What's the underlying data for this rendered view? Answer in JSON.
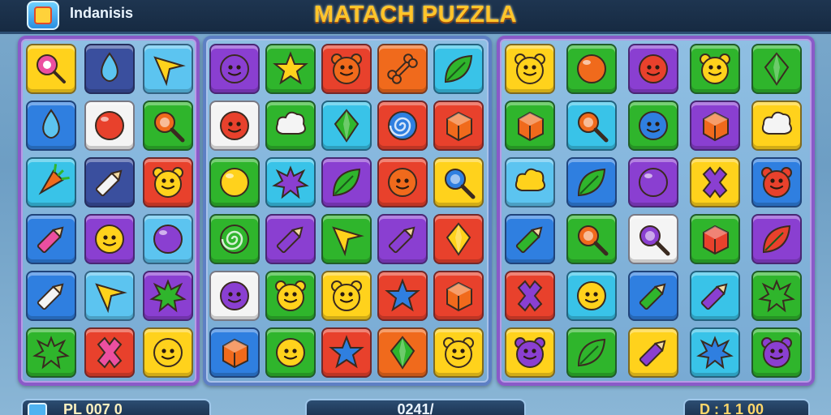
{
  "header": {
    "app_name": "Indanisis",
    "game_title": "MATACH PUZZLA"
  },
  "footer": {
    "left_text": "PL 007 0",
    "center_text": "0241/",
    "right_text": "D : 1 1 00"
  },
  "colors": {
    "red": "#e8412c",
    "orange": "#f06a1c",
    "yellow": "#ffd21c",
    "green": "#2fb52c",
    "lime": "#6ad12a",
    "blue": "#2f7fe0",
    "lightblue": "#5cc4f0",
    "purple": "#8a3fd1",
    "navy": "#3a4f9e",
    "white": "#f4f4f4",
    "pink": "#ec4fa0",
    "cyan": "#39c3e8"
  },
  "boards": [
    {
      "name": "board-left",
      "tiles": [
        {
          "bg": "yellow",
          "icon": "lollipop",
          "fg": "pink"
        },
        {
          "bg": "navy",
          "icon": "drop",
          "fg": "lightblue"
        },
        {
          "bg": "lightblue",
          "icon": "arrow",
          "fg": "yellow"
        },
        {
          "bg": "blue",
          "icon": "drop",
          "fg": "lightblue"
        },
        {
          "bg": "white",
          "icon": "ball",
          "fg": "red"
        },
        {
          "bg": "green",
          "icon": "magnifier",
          "fg": "orange"
        },
        {
          "bg": "cyan",
          "icon": "carrot",
          "fg": "orange"
        },
        {
          "bg": "navy",
          "icon": "pencil",
          "fg": "white"
        },
        {
          "bg": "red",
          "icon": "bear",
          "fg": "yellow"
        },
        {
          "bg": "blue",
          "icon": "pencil",
          "fg": "pink"
        },
        {
          "bg": "purple",
          "icon": "smiley",
          "fg": "yellow"
        },
        {
          "bg": "lightblue",
          "icon": "ball",
          "fg": "purple"
        },
        {
          "bg": "blue",
          "icon": "pencil",
          "fg": "white"
        },
        {
          "bg": "lightblue",
          "icon": "arrow",
          "fg": "yellow"
        },
        {
          "bg": "purple",
          "icon": "splat",
          "fg": "green"
        },
        {
          "bg": "green",
          "icon": "splat",
          "fg": "green"
        },
        {
          "bg": "red",
          "icon": "cross",
          "fg": "pink"
        },
        {
          "bg": "yellow",
          "icon": "smiley",
          "fg": "yellow"
        }
      ]
    },
    {
      "name": "board-middle",
      "tiles": [
        {
          "bg": "purple",
          "icon": "smiley",
          "fg": "purple"
        },
        {
          "bg": "green",
          "icon": "star",
          "fg": "yellow"
        },
        {
          "bg": "red",
          "icon": "bear",
          "fg": "orange"
        },
        {
          "bg": "orange",
          "icon": "bone",
          "fg": "orange"
        },
        {
          "bg": "cyan",
          "icon": "leaf",
          "fg": "green"
        },
        {
          "bg": "white",
          "icon": "smiley",
          "fg": "red"
        },
        {
          "bg": "green",
          "icon": "cloud",
          "fg": "white"
        },
        {
          "bg": "cyan",
          "icon": "gem",
          "fg": "green"
        },
        {
          "bg": "red",
          "icon": "swirl",
          "fg": "blue"
        },
        {
          "bg": "red",
          "icon": "cube",
          "fg": "orange"
        },
        {
          "bg": "green",
          "icon": "ball",
          "fg": "yellow"
        },
        {
          "bg": "cyan",
          "icon": "splat",
          "fg": "purple"
        },
        {
          "bg": "purple",
          "icon": "leaf",
          "fg": "green"
        },
        {
          "bg": "red",
          "icon": "smiley",
          "fg": "orange"
        },
        {
          "bg": "yellow",
          "icon": "magnifier",
          "fg": "blue"
        },
        {
          "bg": "green",
          "icon": "swirl",
          "fg": "green"
        },
        {
          "bg": "purple",
          "icon": "pencil",
          "fg": "purple"
        },
        {
          "bg": "green",
          "icon": "arrow",
          "fg": "yellow"
        },
        {
          "bg": "purple",
          "icon": "pencil",
          "fg": "purple"
        },
        {
          "bg": "red",
          "icon": "gem",
          "fg": "yellow"
        },
        {
          "bg": "white",
          "icon": "smiley",
          "fg": "purple"
        },
        {
          "bg": "green",
          "icon": "bear",
          "fg": "yellow"
        },
        {
          "bg": "yellow",
          "icon": "bear",
          "fg": "yellow"
        },
        {
          "bg": "red",
          "icon": "star",
          "fg": "blue"
        },
        {
          "bg": "red",
          "icon": "cube",
          "fg": "orange"
        },
        {
          "bg": "blue",
          "icon": "cube",
          "fg": "orange"
        },
        {
          "bg": "green",
          "icon": "smiley",
          "fg": "yellow"
        },
        {
          "bg": "red",
          "icon": "star",
          "fg": "blue"
        },
        {
          "bg": "orange",
          "icon": "gem",
          "fg": "green"
        },
        {
          "bg": "yellow",
          "icon": "bear",
          "fg": "yellow"
        }
      ]
    },
    {
      "name": "board-right",
      "tiles": [
        {
          "bg": "yellow",
          "icon": "bear",
          "fg": "yellow"
        },
        {
          "bg": "green",
          "icon": "ball",
          "fg": "orange"
        },
        {
          "bg": "purple",
          "icon": "smiley",
          "fg": "red"
        },
        {
          "bg": "green",
          "icon": "bear",
          "fg": "yellow"
        },
        {
          "bg": "green",
          "icon": "gem",
          "fg": "green"
        },
        {
          "bg": "green",
          "icon": "cube",
          "fg": "orange"
        },
        {
          "bg": "cyan",
          "icon": "magnifier",
          "fg": "orange"
        },
        {
          "bg": "green",
          "icon": "smiley",
          "fg": "blue"
        },
        {
          "bg": "purple",
          "icon": "cube",
          "fg": "orange"
        },
        {
          "bg": "yellow",
          "icon": "cloud",
          "fg": "white"
        },
        {
          "bg": "lightblue",
          "icon": "cloud",
          "fg": "yellow"
        },
        {
          "bg": "blue",
          "icon": "leaf",
          "fg": "green"
        },
        {
          "bg": "purple",
          "icon": "ball",
          "fg": "purple"
        },
        {
          "bg": "yellow",
          "icon": "cross",
          "fg": "purple"
        },
        {
          "bg": "blue",
          "icon": "bear",
          "fg": "red"
        },
        {
          "bg": "blue",
          "icon": "pencil",
          "fg": "green"
        },
        {
          "bg": "green",
          "icon": "magnifier",
          "fg": "orange"
        },
        {
          "bg": "white",
          "icon": "magnifier",
          "fg": "purple"
        },
        {
          "bg": "green",
          "icon": "cube",
          "fg": "red"
        },
        {
          "bg": "purple",
          "icon": "leaf",
          "fg": "red"
        },
        {
          "bg": "red",
          "icon": "cross",
          "fg": "purple"
        },
        {
          "bg": "cyan",
          "icon": "smiley",
          "fg": "yellow"
        },
        {
          "bg": "blue",
          "icon": "pencil",
          "fg": "green"
        },
        {
          "bg": "cyan",
          "icon": "pencil",
          "fg": "purple"
        },
        {
          "bg": "green",
          "icon": "splat",
          "fg": "green"
        },
        {
          "bg": "yellow",
          "icon": "bear",
          "fg": "purple"
        },
        {
          "bg": "green",
          "icon": "leaf",
          "fg": "green"
        },
        {
          "bg": "yellow",
          "icon": "pencil",
          "fg": "purple"
        },
        {
          "bg": "cyan",
          "icon": "splat",
          "fg": "blue"
        },
        {
          "bg": "green",
          "icon": "bear",
          "fg": "purple"
        }
      ]
    }
  ]
}
